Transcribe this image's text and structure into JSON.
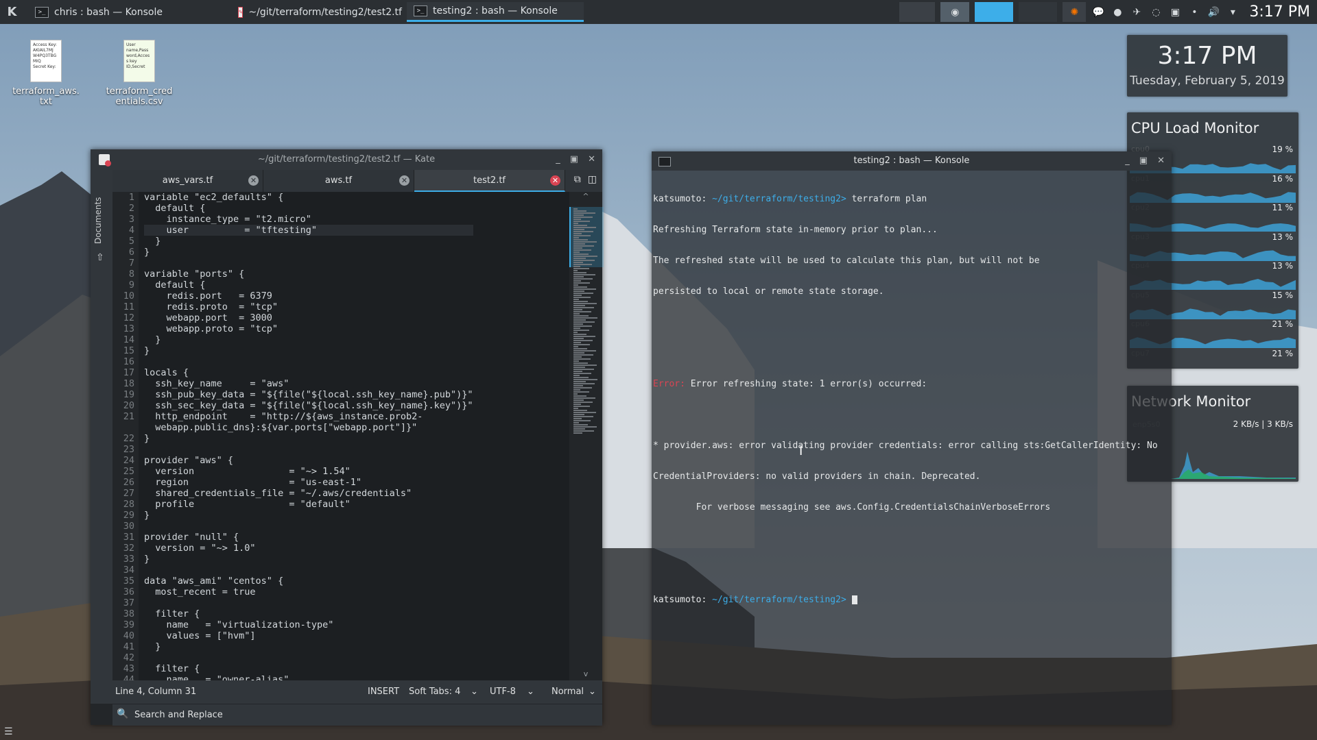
{
  "taskbar": {
    "tasks": [
      {
        "label": "chris : bash — Konsole",
        "icon": "terminal-icon"
      },
      {
        "label": "~/git/terraform/testing2/test2.tf ...",
        "icon": "kate-icon"
      },
      {
        "label": "testing2 : bash — Konsole",
        "icon": "terminal-icon",
        "active": true
      }
    ],
    "clock": "3:17 PM"
  },
  "desktop": {
    "icons": [
      {
        "label": "terraform_aws.\ntxt",
        "preview": "Access Key:\nAKIAIL7MJ\nW4PQ3TBG\nMIQ\nSecret Key:"
      },
      {
        "label": "terraform_cred\nentials.csv",
        "preview": "User\nname,Pass\nword,Acces\ns key\nID,Secret"
      }
    ]
  },
  "clock_widget": {
    "time": "3:17 PM",
    "date": "Tuesday, February 5, 2019"
  },
  "cpu_widget": {
    "title": "CPU Load Monitor",
    "cores": [
      {
        "name": "cpu0",
        "value": "19 %"
      },
      {
        "name": "cpu1",
        "value": "16 %"
      },
      {
        "name": "cpu2",
        "value": "11 %"
      },
      {
        "name": "cpu3",
        "value": "13 %"
      },
      {
        "name": "cpu4",
        "value": "13 %"
      },
      {
        "name": "cpu5",
        "value": "15 %"
      },
      {
        "name": "cpu6",
        "value": "21 %"
      },
      {
        "name": "cpu7",
        "value": "21 %"
      }
    ]
  },
  "net_widget": {
    "title": "Network Monitor",
    "iface": "enp5s0",
    "rate": "2 KB/s | 3 KB/s"
  },
  "kate": {
    "title": "~/git/terraform/testing2/test2.tf — Kate",
    "sidebar_label": "Documents",
    "tabs": [
      {
        "label": "aws_vars.tf"
      },
      {
        "label": "aws.tf"
      },
      {
        "label": "test2.tf",
        "active": true
      }
    ],
    "line_numbers": [
      "1",
      "2",
      "3",
      "4",
      "5",
      "6",
      "7",
      "8",
      "9",
      "10",
      "11",
      "12",
      "13",
      "14",
      "15",
      "16",
      "17",
      "18",
      "19",
      "20",
      "21",
      "",
      "22",
      "23",
      "24",
      "25",
      "26",
      "27",
      "28",
      "29",
      "30",
      "31",
      "32",
      "33",
      "34",
      "35",
      "36",
      "37",
      "38",
      "39",
      "40",
      "41",
      "42",
      "43",
      "44"
    ],
    "lines": [
      "variable \"ec2_defaults\" {",
      "  default {",
      "    instance_type = \"t2.micro\"",
      "    user          = \"tftesting\"",
      "  }",
      "}",
      "",
      "variable \"ports\" {",
      "  default {",
      "    redis.port   = 6379",
      "    redis.proto  = \"tcp\"",
      "    webapp.port  = 3000",
      "    webapp.proto = \"tcp\"",
      "  }",
      "}",
      "",
      "locals {",
      "  ssh_key_name     = \"aws\"",
      "  ssh_pub_key_data = \"${file(\"${local.ssh_key_name}.pub\")}\"",
      "  ssh_sec_key_data = \"${file(\"${local.ssh_key_name}.key\")}\"",
      "  http_endpoint    = \"http://${aws_instance.prob2-",
      "  webapp.public_dns}:${var.ports[\"webapp.port\"]}\"",
      "}",
      "",
      "provider \"aws\" {",
      "  version                 = \"~> 1.54\"",
      "  region                  = \"us-east-1\"",
      "  shared_credentials_file = \"~/.aws/credentials\"",
      "  profile                 = \"default\"",
      "}",
      "",
      "provider \"null\" {",
      "  version = \"~> 1.0\"",
      "}",
      "",
      "data \"aws_ami\" \"centos\" {",
      "  most_recent = true",
      "",
      "  filter {",
      "    name   = \"virtualization-type\"",
      "    values = [\"hvm\"]",
      "  }",
      "",
      "  filter {",
      "    name   = \"owner-alias\""
    ],
    "status": {
      "position": "Line 4, Column 31",
      "mode": "INSERT",
      "tabs": "Soft Tabs: 4",
      "encoding": "UTF-8",
      "highlight": "Normal"
    },
    "find_label": "Search and Replace"
  },
  "konsole": {
    "title": "testing2 : bash — Konsole",
    "prompt_user": "katsumoto:",
    "prompt_path": "~/git/terraform/testing2>",
    "command": "terraform plan",
    "output": [
      "Refreshing Terraform state in-memory prior to plan...",
      "The refreshed state will be used to calculate this plan, but will not be",
      "persisted to local or remote state storage.",
      "",
      "",
      "",
      "",
      "* provider.aws: error validating provider credentials: error calling sts:GetCallerIdentity: No",
      "CredentialProviders: no valid providers in chain. Deprecated.",
      "        For verbose messaging see aws.Config.CredentialsChainVerboseErrors"
    ],
    "error_label": "Error:",
    "error_text": " Error refreshing state: 1 error(s) occurred:"
  },
  "colors": {
    "accent": "#3daee9",
    "error": "#da4453"
  }
}
